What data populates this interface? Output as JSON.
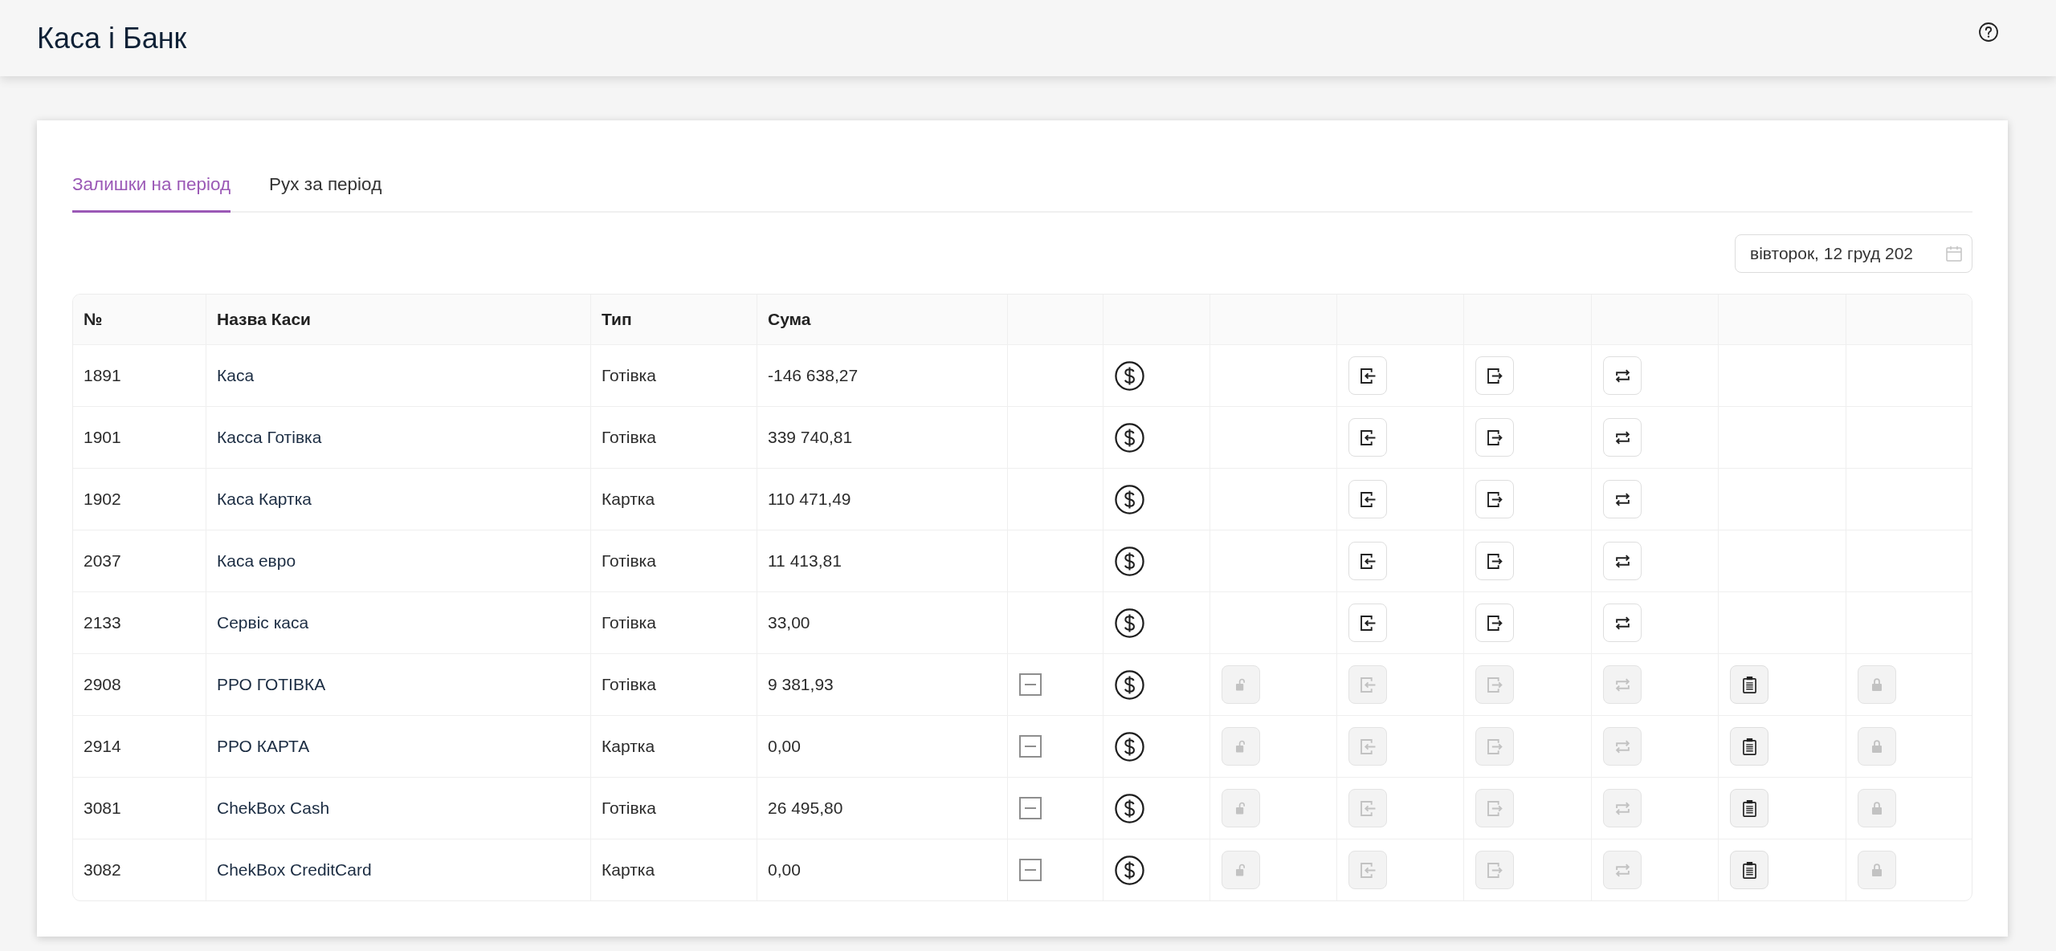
{
  "header": {
    "title": "Каса і Банк"
  },
  "tabs": [
    {
      "label": "Залишки на період",
      "selected": true
    },
    {
      "label": "Рух за період",
      "selected": false
    }
  ],
  "date_field": {
    "value": "вівторок, 12 груд 202"
  },
  "table": {
    "columns": [
      "№",
      "Назва Каси",
      "Тип",
      "Сума"
    ],
    "rows": [
      {
        "number": "1891",
        "name": "Каса",
        "type": "Готівка",
        "sum": "-146 638,27",
        "actions": [
          {
            "kind": "dollar",
            "disabled": false
          },
          {
            "kind": "arrow-in",
            "disabled": false
          },
          {
            "kind": "arrow-out",
            "disabled": false
          },
          {
            "kind": "swap",
            "disabled": false
          }
        ]
      },
      {
        "number": "1901",
        "name": "Касса Готівка",
        "type": "Готівка",
        "sum": "339 740,81",
        "actions": [
          {
            "kind": "dollar",
            "disabled": false
          },
          {
            "kind": "arrow-in",
            "disabled": false
          },
          {
            "kind": "arrow-out",
            "disabled": false
          },
          {
            "kind": "swap",
            "disabled": false
          }
        ]
      },
      {
        "number": "1902",
        "name": "Каса Картка",
        "type": "Картка",
        "sum": "110 471,49",
        "actions": [
          {
            "kind": "dollar",
            "disabled": false
          },
          {
            "kind": "arrow-in",
            "disabled": false
          },
          {
            "kind": "arrow-out",
            "disabled": false
          },
          {
            "kind": "swap",
            "disabled": false
          }
        ]
      },
      {
        "number": "2037",
        "name": "Каса евро",
        "type": "Готівка",
        "sum": "11 413,81",
        "actions": [
          {
            "kind": "dollar",
            "disabled": false
          },
          {
            "kind": "arrow-in",
            "disabled": false
          },
          {
            "kind": "arrow-out",
            "disabled": false
          },
          {
            "kind": "swap",
            "disabled": false
          }
        ]
      },
      {
        "number": "2133",
        "name": "Сервіс каса",
        "type": "Готівка",
        "sum": "33,00",
        "actions": [
          {
            "kind": "dollar",
            "disabled": false
          },
          {
            "kind": "arrow-in",
            "disabled": false
          },
          {
            "kind": "arrow-out",
            "disabled": false
          },
          {
            "kind": "swap",
            "disabled": false
          }
        ]
      },
      {
        "number": "2908",
        "name": "РРО ГОТІВКА",
        "type": "Готівка",
        "sum": "9 381,93",
        "actions": [
          {
            "kind": "minus-box",
            "disabled": true
          },
          {
            "kind": "dollar",
            "disabled": false
          },
          {
            "kind": "unlock",
            "disabled": true
          },
          {
            "kind": "arrow-in",
            "disabled": true
          },
          {
            "kind": "arrow-out",
            "disabled": true
          },
          {
            "kind": "swap",
            "disabled": true
          },
          {
            "kind": "clipboard",
            "disabled": false
          },
          {
            "kind": "lock",
            "disabled": true
          }
        ]
      },
      {
        "number": "2914",
        "name": "РРО КАРТА",
        "type": "Картка",
        "sum": "0,00",
        "actions": [
          {
            "kind": "minus-box",
            "disabled": true
          },
          {
            "kind": "dollar",
            "disabled": false
          },
          {
            "kind": "unlock",
            "disabled": true
          },
          {
            "kind": "arrow-in",
            "disabled": true
          },
          {
            "kind": "arrow-out",
            "disabled": true
          },
          {
            "kind": "swap",
            "disabled": true
          },
          {
            "kind": "clipboard",
            "disabled": false
          },
          {
            "kind": "lock",
            "disabled": true
          }
        ]
      },
      {
        "number": "3081",
        "name": "ChekBox Cash",
        "type": "Готівка",
        "sum": "26 495,80",
        "actions": [
          {
            "kind": "minus-box",
            "disabled": true
          },
          {
            "kind": "dollar",
            "disabled": false
          },
          {
            "kind": "unlock",
            "disabled": true
          },
          {
            "kind": "arrow-in",
            "disabled": true
          },
          {
            "kind": "arrow-out",
            "disabled": true
          },
          {
            "kind": "swap",
            "disabled": true
          },
          {
            "kind": "clipboard",
            "disabled": false
          },
          {
            "kind": "lock",
            "disabled": true
          }
        ]
      },
      {
        "number": "3082",
        "name": "ChekBox CreditCard",
        "type": "Картка",
        "sum": "0,00",
        "actions": [
          {
            "kind": "minus-box",
            "disabled": true
          },
          {
            "kind": "dollar",
            "disabled": false
          },
          {
            "kind": "unlock",
            "disabled": true
          },
          {
            "kind": "arrow-in",
            "disabled": true
          },
          {
            "kind": "arrow-out",
            "disabled": true
          },
          {
            "kind": "swap",
            "disabled": true
          },
          {
            "kind": "clipboard",
            "disabled": false
          },
          {
            "kind": "lock",
            "disabled": true
          }
        ]
      }
    ]
  }
}
